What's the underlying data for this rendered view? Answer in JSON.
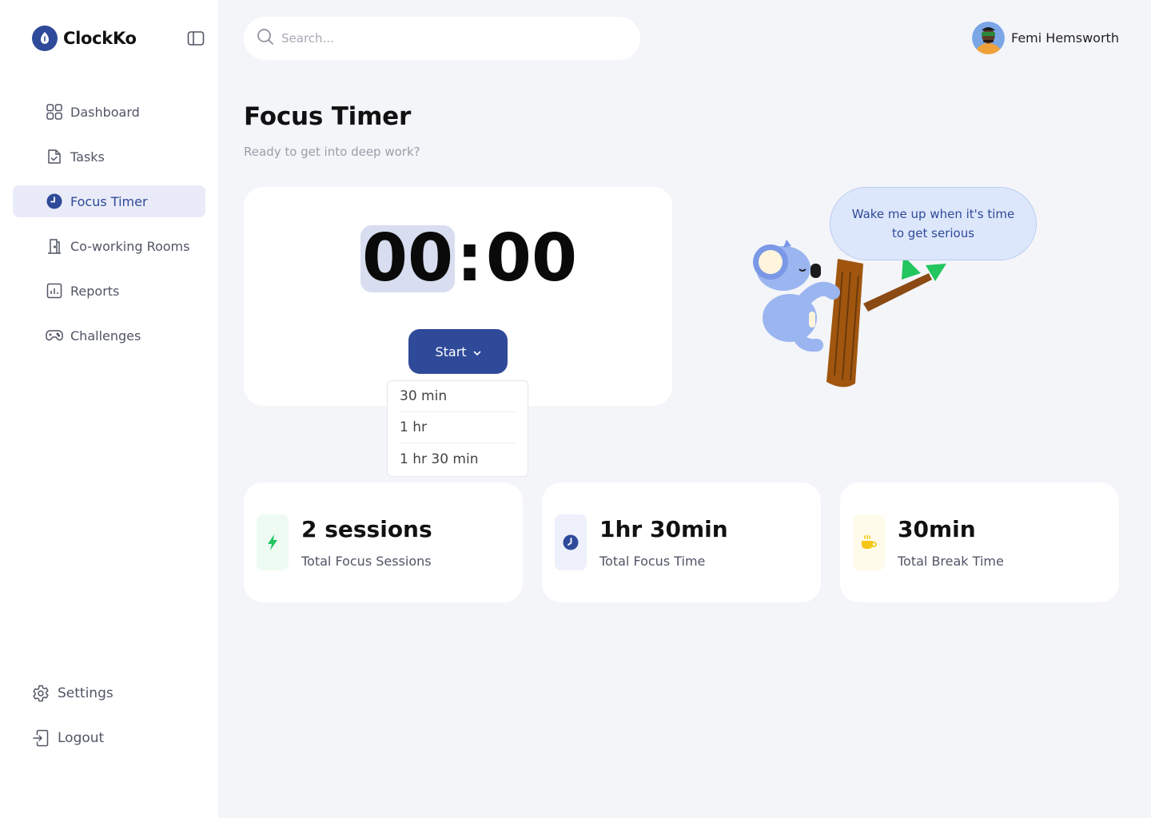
{
  "app": {
    "name": "ClockKo"
  },
  "sidebar": {
    "items": [
      {
        "label": "Dashboard",
        "icon": "grid-icon"
      },
      {
        "label": "Tasks",
        "icon": "task-file-icon"
      },
      {
        "label": "Focus Timer",
        "icon": "clock-icon",
        "active": true
      },
      {
        "label": "Co-working Rooms",
        "icon": "door-icon"
      },
      {
        "label": "Reports",
        "icon": "chart-icon"
      },
      {
        "label": "Challenges",
        "icon": "gamepad-icon"
      }
    ],
    "bottom": [
      {
        "label": "Settings",
        "icon": "gear-icon"
      },
      {
        "label": "Logout",
        "icon": "logout-icon"
      }
    ]
  },
  "search": {
    "placeholder": "Search..."
  },
  "user": {
    "name": "Femi Hemsworth"
  },
  "page": {
    "title": "Focus Timer",
    "subtitle": "Ready to get into deep work?"
  },
  "timer": {
    "minutes": "00",
    "separator": ":",
    "seconds": "00",
    "start_label": "Start",
    "options": [
      "30 min",
      "1 hr",
      "1 hr 30 min"
    ]
  },
  "mascot": {
    "bubble": "Wake me up when it's time to get serious"
  },
  "stats": [
    {
      "value": "2 sessions",
      "label": "Total Focus Sessions",
      "icon": "lightning-icon",
      "color": "#22c55e"
    },
    {
      "value": "1hr 30min",
      "label": "Total Focus Time",
      "icon": "clock-icon",
      "color": "#2f4a99"
    },
    {
      "value": "30min",
      "label": "Total Break Time",
      "icon": "coffee-cup-icon",
      "color": "#f5c518"
    }
  ],
  "colors": {
    "accent": "#2f4a99",
    "active_bg": "#e9ebf8",
    "background": "#f4f5f9"
  }
}
